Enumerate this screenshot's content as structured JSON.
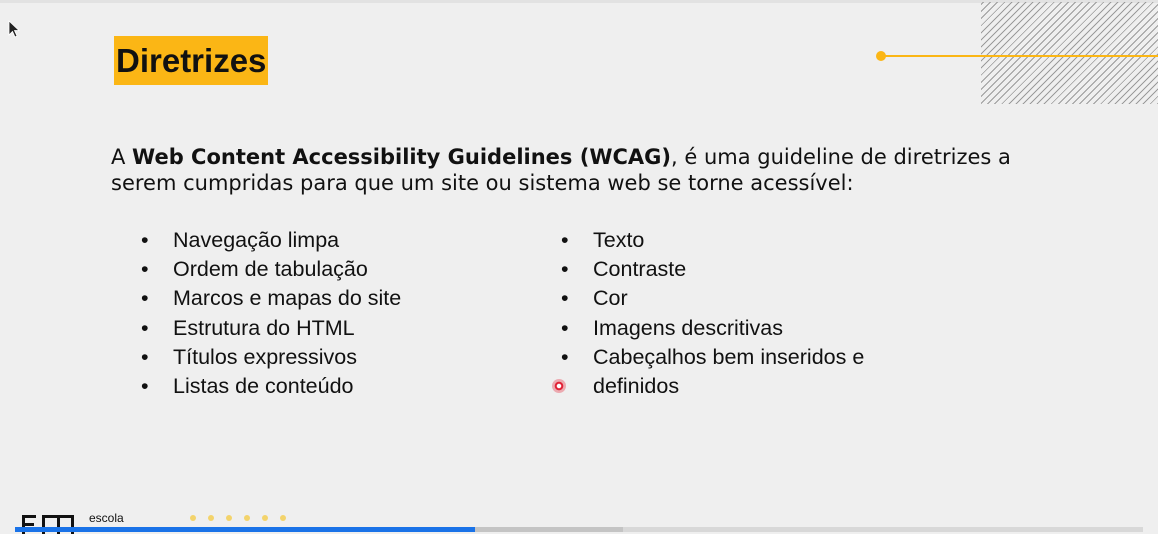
{
  "slide": {
    "title": "Diretrizes",
    "intro": {
      "prefix": "A ",
      "bold": "Web Content Accessibility Guidelines (WCAG)",
      "suffix": ", é uma guideline de diretrizes a serem cumpridas para que um site ou sistema web se torne acessível:"
    },
    "bullet_glyph": "•",
    "left_items": [
      "Navegação limpa",
      "Ordem de tabulação",
      "Marcos e mapas do site",
      "Estrutura do HTML",
      "Títulos expressivos",
      "Listas de conteúdo"
    ],
    "right_items": [
      "Texto",
      "Contraste",
      "Cor",
      "Imagens descritivas",
      "Cabeçalhos bem inseridos e"
    ],
    "right_continuation": "definidos",
    "footer_brand": "escola"
  },
  "player": {
    "progress": 0.408,
    "buffered": 0.539
  },
  "colors": {
    "accent": "#fbb615",
    "progress": "#1a73e8",
    "text": "#111111",
    "background": "#efefef"
  },
  "icons": {
    "cursor": "arrow-cursor-icon",
    "pointer": "laser-pointer-icon",
    "logo": "school-logo-icon"
  }
}
